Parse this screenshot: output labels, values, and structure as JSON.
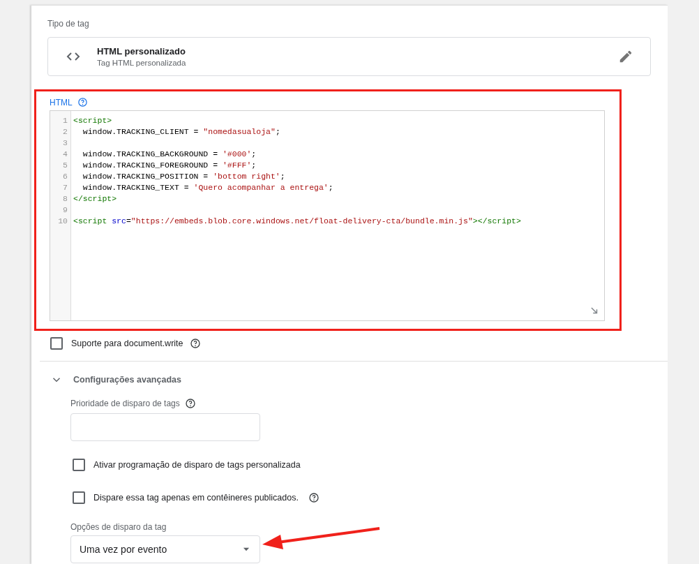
{
  "tag_type": {
    "label": "Tipo de tag",
    "name": "HTML personalizado",
    "description": "Tag HTML personalizada"
  },
  "html_field": {
    "label": "HTML",
    "highlighted": true,
    "lines": [
      {
        "kind": "code",
        "tokens": [
          {
            "kind": "tag",
            "text": "<script>"
          }
        ]
      },
      {
        "kind": "code",
        "tokens": [
          {
            "kind": "plain",
            "text": "  window.TRACKING_CLIENT = "
          },
          {
            "kind": "string",
            "text": "\"nomedasualoja\""
          },
          {
            "kind": "plain",
            "text": ";"
          }
        ]
      },
      {
        "kind": "blank"
      },
      {
        "kind": "code",
        "tokens": [
          {
            "kind": "plain",
            "text": "  window.TRACKING_BACKGROUND = "
          },
          {
            "kind": "string",
            "text": "'#000'"
          },
          {
            "kind": "plain",
            "text": ";"
          }
        ]
      },
      {
        "kind": "code",
        "tokens": [
          {
            "kind": "plain",
            "text": "  window.TRACKING_FOREGROUND = "
          },
          {
            "kind": "string",
            "text": "'#FFF'"
          },
          {
            "kind": "plain",
            "text": ";"
          }
        ]
      },
      {
        "kind": "code",
        "tokens": [
          {
            "kind": "plain",
            "text": "  window.TRACKING_POSITION = "
          },
          {
            "kind": "string",
            "text": "'bottom right'"
          },
          {
            "kind": "plain",
            "text": ";"
          }
        ]
      },
      {
        "kind": "code",
        "tokens": [
          {
            "kind": "plain",
            "text": "  window.TRACKING_TEXT = "
          },
          {
            "kind": "string",
            "text": "'Quero acompanhar a entrega'"
          },
          {
            "kind": "plain",
            "text": ";"
          }
        ]
      },
      {
        "kind": "code",
        "tokens": [
          {
            "kind": "tag",
            "text": "</script>"
          }
        ]
      },
      {
        "kind": "blank"
      },
      {
        "kind": "code",
        "tokens": [
          {
            "kind": "tag",
            "text": "<script "
          },
          {
            "kind": "attr",
            "text": "src"
          },
          {
            "kind": "plain",
            "text": "="
          },
          {
            "kind": "string",
            "text": "\"https://embeds.blob.core.windows.net/float-delivery-cta/bundle.min.js\""
          },
          {
            "kind": "tag",
            "text": "></script>"
          }
        ]
      }
    ],
    "line_numbers": [
      "1",
      "2",
      "3",
      "4",
      "5",
      "6",
      "7",
      "8",
      "9",
      "10"
    ]
  },
  "document_write": {
    "label": "Suporte para document.write",
    "checked": false
  },
  "advanced": {
    "title": "Configurações avançadas",
    "expanded": true,
    "priority_label": "Prioridade de disparo de tags",
    "checkboxes": [
      {
        "label": "Ativar programação de disparo de tags personalizada",
        "checked": false,
        "help": false
      },
      {
        "label": "Dispare essa tag apenas em contêineres publicados.",
        "checked": false,
        "help": true
      }
    ],
    "firing_label": "Opções de disparo da tag",
    "firing_value": "Uma vez por evento",
    "arrow": true
  }
}
